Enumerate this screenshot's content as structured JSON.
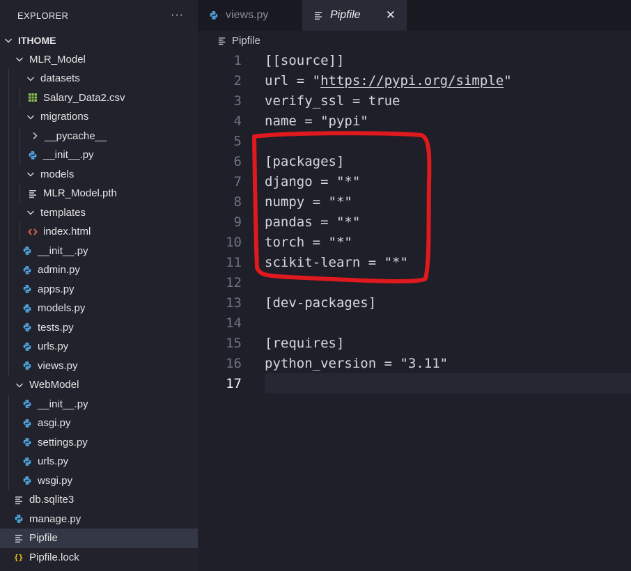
{
  "explorer": {
    "title": "EXPLORER",
    "more": "···"
  },
  "tree": [
    {
      "label": "ITHOME",
      "depth": 0,
      "icon": "chevron-down-icon",
      "root": true
    },
    {
      "label": "MLR_Model",
      "depth": 1,
      "icon": "chevron-down-icon"
    },
    {
      "label": "datasets",
      "depth": 2,
      "icon": "chevron-down-icon"
    },
    {
      "label": "Salary_Data2.csv",
      "depth": 3,
      "icon": "csv-icon"
    },
    {
      "label": "migrations",
      "depth": 2,
      "icon": "chevron-down-icon"
    },
    {
      "label": "__pycache__",
      "depth": 3,
      "icon": "chevron-right-icon"
    },
    {
      "label": "__init__.py",
      "depth": 3,
      "icon": "python-icon"
    },
    {
      "label": "models",
      "depth": 2,
      "icon": "chevron-down-icon"
    },
    {
      "label": "MLR_Model.pth",
      "depth": 3,
      "icon": "lines-icon"
    },
    {
      "label": "templates",
      "depth": 2,
      "icon": "chevron-down-icon"
    },
    {
      "label": "index.html",
      "depth": 3,
      "icon": "html-icon"
    },
    {
      "label": "__init__.py",
      "depth": 2,
      "icon": "python-icon"
    },
    {
      "label": "admin.py",
      "depth": 2,
      "icon": "python-icon"
    },
    {
      "label": "apps.py",
      "depth": 2,
      "icon": "python-icon"
    },
    {
      "label": "models.py",
      "depth": 2,
      "icon": "python-icon"
    },
    {
      "label": "tests.py",
      "depth": 2,
      "icon": "python-icon"
    },
    {
      "label": "urls.py",
      "depth": 2,
      "icon": "python-icon"
    },
    {
      "label": "views.py",
      "depth": 2,
      "icon": "python-icon"
    },
    {
      "label": "WebModel",
      "depth": 1,
      "icon": "chevron-down-icon"
    },
    {
      "label": "__init__.py",
      "depth": 2,
      "icon": "python-icon"
    },
    {
      "label": "asgi.py",
      "depth": 2,
      "icon": "python-icon"
    },
    {
      "label": "settings.py",
      "depth": 2,
      "icon": "python-icon"
    },
    {
      "label": "urls.py",
      "depth": 2,
      "icon": "python-icon"
    },
    {
      "label": "wsgi.py",
      "depth": 2,
      "icon": "python-icon"
    },
    {
      "label": "db.sqlite3",
      "depth": 1,
      "icon": "lines-icon"
    },
    {
      "label": "manage.py",
      "depth": 1,
      "icon": "python-icon"
    },
    {
      "label": "Pipfile",
      "depth": 1,
      "icon": "lines-icon",
      "selected": true
    },
    {
      "label": "Pipfile.lock",
      "depth": 1,
      "icon": "json-icon"
    }
  ],
  "tabs": [
    {
      "label": "views.py",
      "icon": "python-icon",
      "active": false
    },
    {
      "label": "Pipfile",
      "icon": "lines-icon",
      "active": true,
      "close": "✕"
    }
  ],
  "breadcrumb": {
    "label": "Pipfile"
  },
  "editor": {
    "current_line": 17,
    "lines": [
      "[[source]]",
      "url = \"https://pypi.org/simple\"",
      "verify_ssl = true",
      "name = \"pypi\"",
      "",
      "[packages]",
      "django = \"*\"",
      "numpy = \"*\"",
      "pandas = \"*\"",
      "torch = \"*\"",
      "scikit-learn = \"*\"",
      "",
      "[dev-packages]",
      "",
      "[requires]",
      "python_version = \"3.11\"",
      ""
    ]
  },
  "colors": {
    "python_icon": "#4f9fd8",
    "csv_icon": "#8bc34a",
    "html_icon": "#e36d4a",
    "json_icon": "#f1c40f",
    "annotation": "#e0191e"
  }
}
